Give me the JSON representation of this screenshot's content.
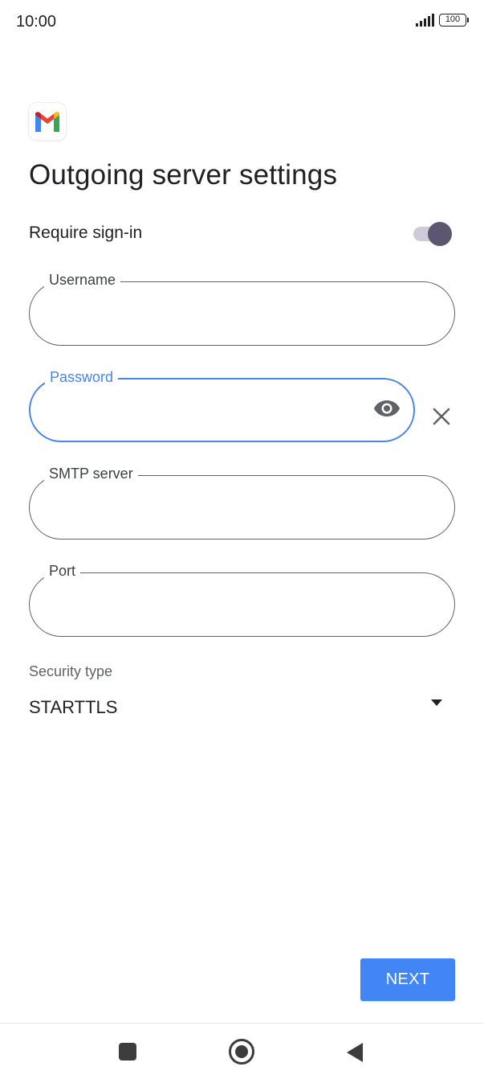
{
  "status_bar": {
    "time": "10:00",
    "battery": "100"
  },
  "page": {
    "title": "Outgoing server settings"
  },
  "require_signin": {
    "label": "Require sign-in",
    "enabled": true
  },
  "fields": {
    "username": {
      "label": "Username",
      "value": ""
    },
    "password": {
      "label": "Password",
      "value": ""
    },
    "smtp_server": {
      "label": "SMTP server",
      "value": ""
    },
    "port": {
      "label": "Port",
      "value": ""
    }
  },
  "security": {
    "label": "Security type",
    "value": "STARTTLS"
  },
  "actions": {
    "next_label": "NEXT"
  },
  "colors": {
    "accent": "#4285f4",
    "focus": "#4a86e8",
    "toggle_thumb": "#5c5670"
  },
  "icons": [
    "gmail-logo",
    "eye-icon",
    "close-icon",
    "dropdown-arrow-icon",
    "recent-apps-icon",
    "home-icon",
    "back-icon"
  ]
}
